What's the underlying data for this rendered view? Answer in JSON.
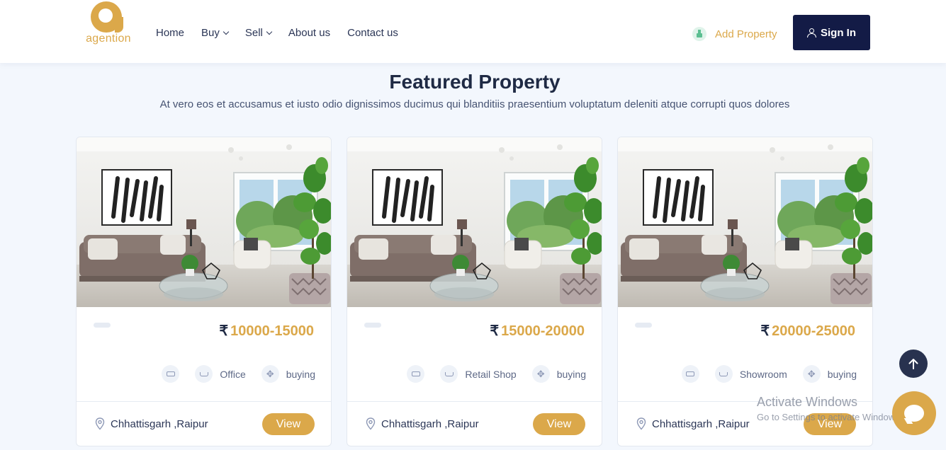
{
  "header": {
    "logo_text": "agention",
    "nav": [
      {
        "label": "Home",
        "dropdown": false
      },
      {
        "label": "Buy",
        "dropdown": true
      },
      {
        "label": "Sell",
        "dropdown": true
      },
      {
        "label": "About us",
        "dropdown": false
      },
      {
        "label": "Contact us",
        "dropdown": false
      }
    ],
    "add_property": "Add Property",
    "sign_in": "Sign In"
  },
  "section": {
    "title": "Featured Property",
    "subtitle": "At vero eos et accusamus et iusto odio dignissimos ducimus qui blanditiis praesentium voluptatum deleniti atque corrupti quos dolores"
  },
  "cards": [
    {
      "currency": "₹",
      "price": "10000-15000",
      "type": "Office",
      "purpose": "buying",
      "location": "Chhattisgarh ,Raipur",
      "view": "View"
    },
    {
      "currency": "₹",
      "price": "15000-20000",
      "type": "Retail Shop",
      "purpose": "buying",
      "location": "Chhattisgarh ,Raipur",
      "view": "View"
    },
    {
      "currency": "₹",
      "price": "20000-25000",
      "type": "Showroom",
      "purpose": "buying",
      "location": "Chhattisgarh ,Raipur",
      "view": "View"
    }
  ],
  "watermark": {
    "line1": "Activate Windows",
    "line2": "Go to Settings to activate Windows."
  },
  "colors": {
    "accent": "#dba84a",
    "navy": "#131b46",
    "background": "#f3f7fd"
  }
}
